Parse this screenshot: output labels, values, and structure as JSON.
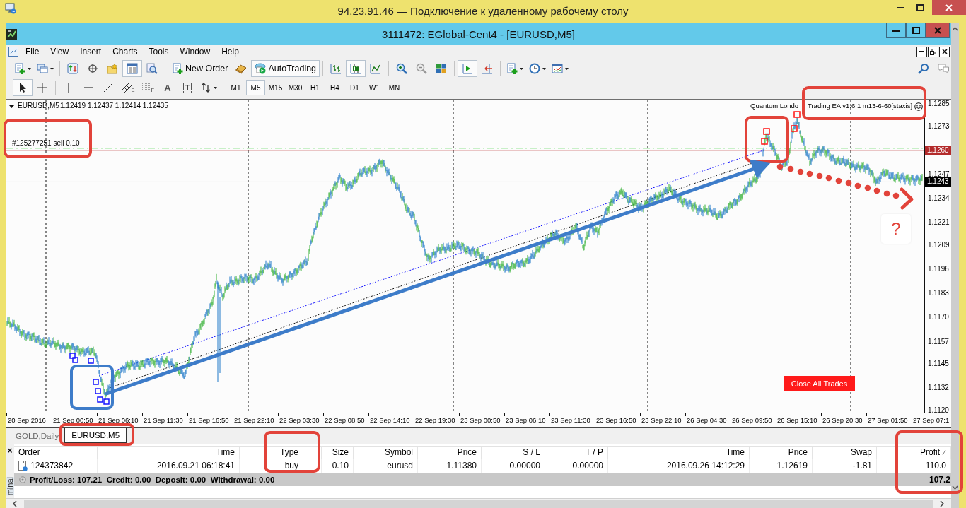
{
  "rdp_window": {
    "title": "94.23.91.46 — Подключение к удаленному рабочему столу"
  },
  "app_window": {
    "title": "3111472: EGlobal-Cent4 - [EURUSD,M5]"
  },
  "menu": [
    "File",
    "View",
    "Insert",
    "Charts",
    "Tools",
    "Window",
    "Help"
  ],
  "toolbar": [
    [
      {
        "kind": "new-chart",
        "dropdown": true,
        "pressed": false
      },
      {
        "kind": "profiles",
        "dropdown": true,
        "pressed": false
      }
    ],
    [
      {
        "kind": "market-watch",
        "dropdown": false,
        "pressed": false
      },
      {
        "kind": "navigator",
        "dropdown": false,
        "pressed": false
      },
      {
        "kind": "favorites",
        "dropdown": false,
        "pressed": false
      },
      {
        "kind": "data-window",
        "dropdown": false,
        "pressed": true
      },
      {
        "kind": "tester",
        "dropdown": false,
        "pressed": false
      }
    ],
    [
      {
        "kind": "new-order",
        "label": "New Order",
        "dropdown": false,
        "pressed": false
      },
      {
        "kind": "editor",
        "dropdown": false,
        "pressed": false
      },
      {
        "kind": "autotrading",
        "label": "AutoTrading",
        "dropdown": false,
        "pressed": true
      }
    ],
    [
      {
        "kind": "bar-chart",
        "dropdown": false,
        "pressed": false
      },
      {
        "kind": "candle-chart",
        "dropdown": false,
        "pressed": true
      },
      {
        "kind": "line-chart",
        "dropdown": false,
        "pressed": false
      }
    ],
    [
      {
        "kind": "zoom-in",
        "dropdown": false,
        "pressed": false
      },
      {
        "kind": "zoom-out",
        "dropdown": false,
        "pressed": false
      },
      {
        "kind": "tile",
        "dropdown": false,
        "pressed": false
      }
    ],
    [
      {
        "kind": "autoscroll",
        "dropdown": false,
        "pressed": true
      },
      {
        "kind": "chart-shift",
        "dropdown": false,
        "pressed": false
      }
    ],
    [
      {
        "kind": "indicators",
        "dropdown": true,
        "pressed": false
      },
      {
        "kind": "periods",
        "dropdown": true,
        "pressed": false
      },
      {
        "kind": "templates",
        "dropdown": true,
        "pressed": false
      }
    ]
  ],
  "drawing_tools": [
    [
      {
        "kind": "cursor",
        "selected": true,
        "dropdown": false
      },
      {
        "kind": "crosshair",
        "selected": false,
        "dropdown": false
      }
    ],
    [
      {
        "kind": "vertical-line",
        "selected": false,
        "dropdown": false
      },
      {
        "kind": "horizontal-line",
        "selected": false,
        "dropdown": false
      },
      {
        "kind": "trendline",
        "selected": false,
        "dropdown": false
      },
      {
        "kind": "channel",
        "label": "E",
        "selected": false,
        "dropdown": false
      },
      {
        "kind": "fibonacci",
        "label": "F",
        "selected": false,
        "dropdown": false
      },
      {
        "kind": "text",
        "label": "A",
        "selected": false,
        "dropdown": false
      },
      {
        "kind": "text-label",
        "label": "T",
        "selected": false,
        "dropdown": false
      },
      {
        "kind": "arrows",
        "selected": false,
        "dropdown": true
      }
    ]
  ],
  "timeframes": [
    {
      "label": "M1",
      "selected": false
    },
    {
      "label": "M5",
      "selected": true
    },
    {
      "label": "M15",
      "selected": false
    },
    {
      "label": "M30",
      "selected": false
    },
    {
      "label": "H1",
      "selected": false
    },
    {
      "label": "H4",
      "selected": false
    },
    {
      "label": "D1",
      "selected": false
    },
    {
      "label": "W1",
      "selected": false
    },
    {
      "label": "MN",
      "selected": false
    }
  ],
  "chart": {
    "symbol": "EURUSD,M5",
    "quotes": "1.12419 1.12437 1.12414 1.12435",
    "order_label": "#125277251 sell 0.10",
    "ea_label": [
      "Quantum Londo",
      "Trading EA v1.6.1 m13-6-60[staxis]"
    ],
    "close_button": "Close All Trades",
    "price_ticks": [
      "1.1285",
      "1.1273",
      "1.1247",
      "1.1234",
      "1.1221",
      "1.1209",
      "1.1196",
      "1.1183",
      "1.1170",
      "1.1157",
      "1.1145",
      "1.1132",
      "1.1120"
    ],
    "price_markers": [
      {
        "text": "1.1260",
        "kind": "order"
      },
      {
        "text": "1.1243",
        "kind": "bid"
      }
    ],
    "time_ticks": [
      "20 Sep 2016",
      "21 Sep 00:50",
      "21 Sep 06:10",
      "21 Sep 11:30",
      "21 Sep 16:50",
      "21 Sep 22:10",
      "22 Sep 03:30",
      "22 Sep 08:50",
      "22 Sep 14:10",
      "22 Sep 19:30",
      "23 Sep 00:50",
      "23 Sep 06:10",
      "23 Sep 11:30",
      "23 Sep 16:50",
      "23 Sep 22:10",
      "26 Sep 04:30",
      "26 Sep 09:50",
      "26 Sep 15:10",
      "26 Sep 20:30",
      "27 Sep 01:50",
      "27 Sep 07:1"
    ]
  },
  "chart_tabs": [
    {
      "label": "GOLD,Daily",
      "selected": false
    },
    {
      "label": "EURUSD,M5",
      "selected": true
    }
  ],
  "terminal": {
    "close": "×",
    "side_label": "minal",
    "columns": [
      "Order",
      "Time",
      "Type",
      "Size",
      "Symbol",
      "Price",
      "S / L",
      "T / P",
      "Time",
      "Price",
      "Swap",
      "Profit"
    ],
    "rows": [
      {
        "cells": [
          "124373842",
          "2016.09.21 06:18:41",
          "buy",
          "0.10",
          "eurusd",
          "1.11380",
          "0.00000",
          "0.00000",
          "2016.09.26 14:12:29",
          "1.12619",
          "-1.81",
          "110.0"
        ]
      }
    ],
    "summary": "Profit/Loss: 107.21  Credit: 0.00  Deposit: 0.00  Withdrawal: 0.00",
    "summary_total": "107.2"
  },
  "annotation": {
    "question": "?"
  }
}
